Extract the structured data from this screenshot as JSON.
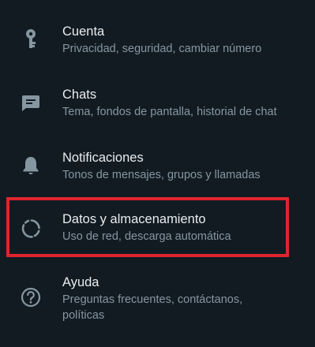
{
  "settings": {
    "items": [
      {
        "icon": "key-icon",
        "title": "Cuenta",
        "subtitle": "Privacidad, seguridad, cambiar número"
      },
      {
        "icon": "chat-icon",
        "title": "Chats",
        "subtitle": "Tema, fondos de pantalla, historial de chat"
      },
      {
        "icon": "bell-icon",
        "title": "Notificaciones",
        "subtitle": "Tonos de mensajes, grupos y llamadas"
      },
      {
        "icon": "data-usage-icon",
        "title": "Datos y almacenamiento",
        "subtitle": "Uso de red, descarga automática"
      },
      {
        "icon": "help-icon",
        "title": "Ayuda",
        "subtitle": "Preguntas frecuentes, contáctanos, políticas"
      }
    ]
  },
  "colors": {
    "background": "#121b22",
    "title_text": "#e9edef",
    "subtitle_text": "#8696a0",
    "icon": "#8696a0",
    "highlight": "#e0242e"
  }
}
